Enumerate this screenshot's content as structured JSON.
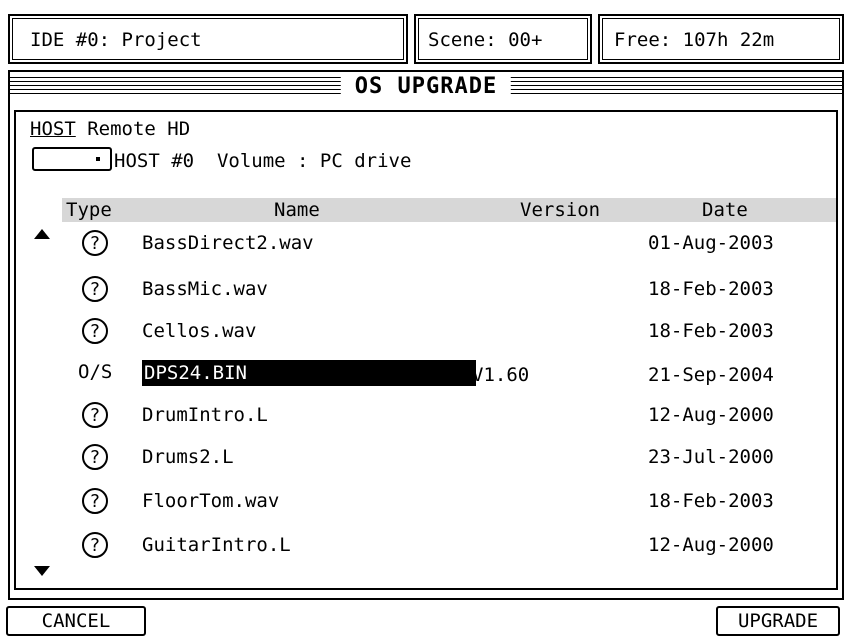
{
  "status_bar": {
    "project": "IDE #0: Project",
    "scene": "Scene: 00+",
    "free": "Free: 107h 22m"
  },
  "dialog": {
    "title": "OS UPGRADE",
    "host_label_prefix": "HOST",
    "host_label_suffix": " Remote HD",
    "host_info": "HOST #0  Volume : PC drive"
  },
  "table": {
    "columns": [
      "Type",
      "Name",
      "Version",
      "Date"
    ],
    "rows": [
      {
        "type": "?",
        "name": "BassDirect2.wav",
        "version": "",
        "date": "01-Aug-2003"
      },
      {
        "type": "?",
        "name": "BassMic.wav",
        "version": "",
        "date": "18-Feb-2003"
      },
      {
        "type": "?",
        "name": "Cellos.wav",
        "version": "",
        "date": "18-Feb-2003"
      },
      {
        "type": "O/S",
        "name": "DPS24.BIN",
        "version": "V1.60",
        "date": "21-Sep-2004"
      },
      {
        "type": "?",
        "name": "DrumIntro.L",
        "version": "",
        "date": "12-Aug-2000"
      },
      {
        "type": "?",
        "name": "Drums2.L",
        "version": "",
        "date": "23-Jul-2000"
      },
      {
        "type": "?",
        "name": "FloorTom.wav",
        "version": "",
        "date": "18-Feb-2003"
      },
      {
        "type": "?",
        "name": "GuitarIntro.L",
        "version": "",
        "date": "12-Aug-2000"
      }
    ]
  },
  "buttons": {
    "cancel": "CANCEL",
    "upgrade": "UPGRADE"
  }
}
